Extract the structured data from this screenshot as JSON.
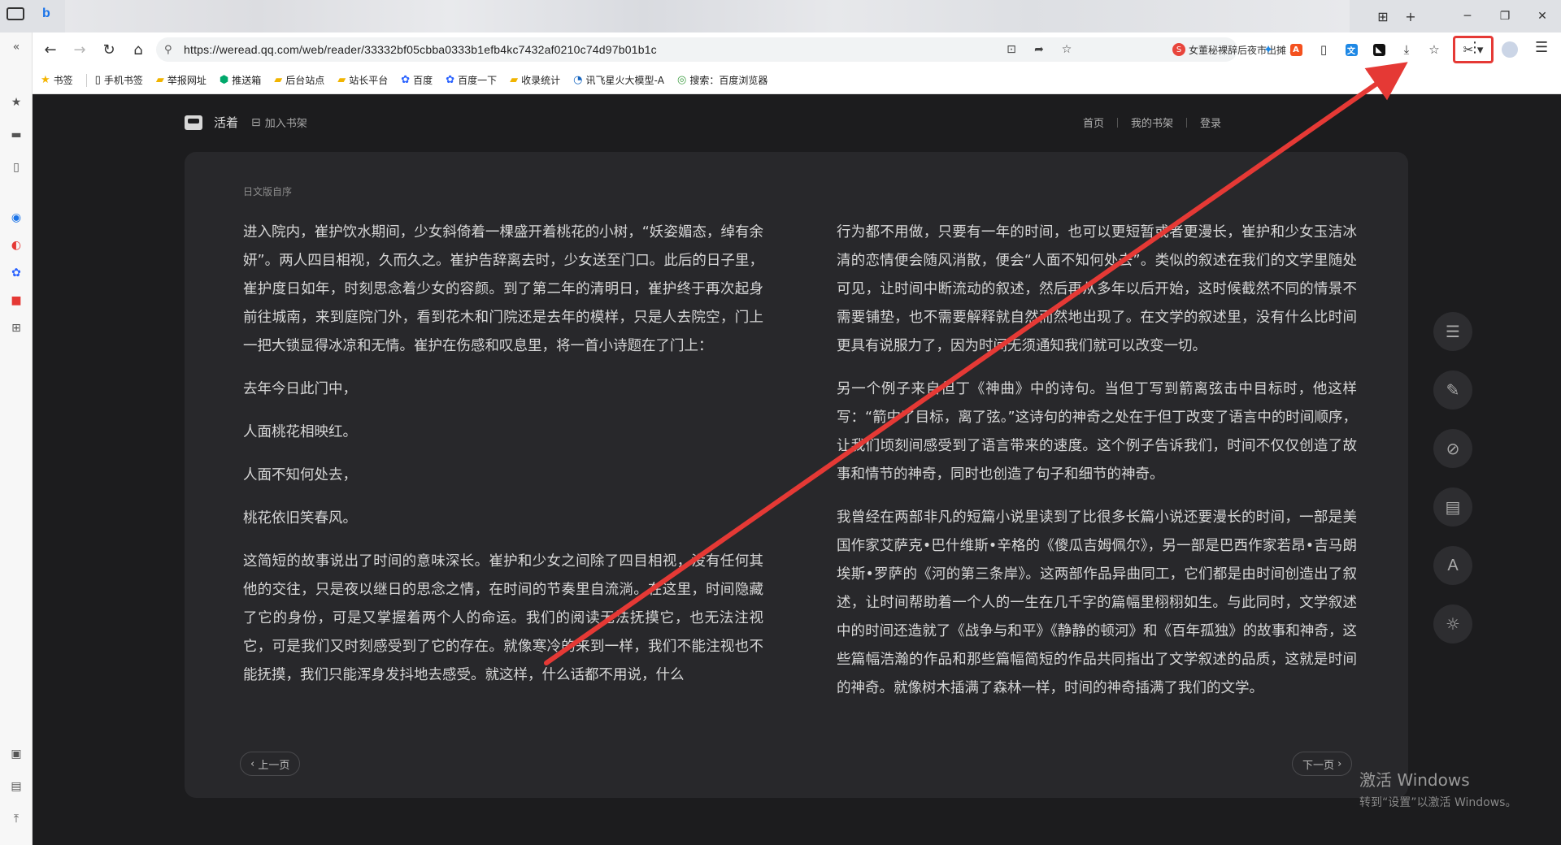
{
  "browser": {
    "address_url": "https://weread.qq.com/web/reader/33332bf05cbba0333b1efb4kc7432af0210c74d97b01b1c",
    "search_hint": "女董秘裸辞后夜市出摊 收",
    "new_tab_label": "+",
    "window": {
      "minimize": "─",
      "restore": "❐",
      "close": "✕"
    }
  },
  "bookmarks": [
    {
      "label": "书签",
      "icon": "star-icon"
    },
    {
      "label": "手机书签",
      "icon": "phone-icon"
    },
    {
      "label": "举报网址",
      "icon": "folder-icon"
    },
    {
      "label": "推送箱",
      "icon": "push-icon"
    },
    {
      "label": "后台站点",
      "icon": "folder-icon"
    },
    {
      "label": "站长平台",
      "icon": "folder-icon"
    },
    {
      "label": "百度",
      "icon": "baidu-icon"
    },
    {
      "label": "百度一下",
      "icon": "baidu-icon"
    },
    {
      "label": "收录统计",
      "icon": "folder-icon"
    },
    {
      "label": "讯飞星火大模型-A",
      "icon": "spark-icon"
    },
    {
      "label": "搜索：百度浏览器",
      "icon": "search-engine-icon"
    }
  ],
  "reader": {
    "book_title": "活着",
    "add_to_shelf": "加入书架",
    "nav": {
      "home": "首页",
      "my_shelf": "我的书架",
      "login": "登录"
    },
    "chapter": "日文版自序",
    "left_paragraphs": [
      "进入院内，崔护饮水期间，少女斜倚着一棵盛开着桃花的小树，“妖姿媚态，绰有余妍”。两人四目相视，久而久之。崔护告辞离去时，少女送至门口。此后的日子里，崔护度日如年，时刻思念着少女的容颜。到了第二年的清明日，崔护终于再次起身前往城南，来到庭院门外，看到花木和门院还是去年的模样，只是人去院空，门上一把大锁显得冰凉和无情。崔护在伤感和叹息里，将一首小诗题在了门上：",
      "去年今日此门中，",
      "人面桃花相映红。",
      "人面不知何处去，",
      "桃花依旧笑春风。",
      "这简短的故事说出了时间的意味深长。崔护和少女之间除了四目相视，没有任何其他的交往，只是夜以继日的思念之情，在时间的节奏里自流淌。在这里，时间隐藏了它的身份，可是又掌握着两个人的命运。我们的阅读无法抚摸它，也无法注视它，可是我们又时刻感受到了它的存在。就像寒冷的来到一样，我们不能注视也不能抚摸，我们只能浑身发抖地去感受。就这样，什么话都不用说，什么"
    ],
    "right_paragraphs": [
      "行为都不用做，只要有一年的时间，也可以更短暂或者更漫长，崔护和少女玉洁冰清的恋情便会随风消散，便会“人面不知何处去”。类似的叙述在我们的文学里随处可见，让时间中断流动的叙述，然后再从多年以后开始，这时候截然不同的情景不需要铺垫，也不需要解释就自然而然地出现了。在文学的叙述里，没有什么比时间更具有说服力了，因为时间无须通知我们就可以改变一切。",
      "另一个例子来自但丁《神曲》中的诗句。当但丁写到箭离弦击中目标时，他这样写：“箭中了目标，离了弦。”这诗句的神奇之处在于但丁改变了语言中的时间顺序，让我们顷刻间感受到了语言带来的速度。这个例子告诉我们，时间不仅仅创造了故事和情节的神奇，同时也创造了句子和细节的神奇。",
      "我曾经在两部非凡的短篇小说里读到了比很多长篇小说还要漫长的时间，一部是美国作家艾萨克•巴什维斯•辛格的《傻瓜吉姆佩尔》，另一部是巴西作家若昂•吉马朗埃斯•罗萨的《河的第三条岸》。这两部作品异曲同工，它们都是由时间创造出了叙述，让时间帮助着一个人的一生在几千字的篇幅里栩栩如生。与此同时，文学叙述中的时间还造就了《战争与和平》《静静的顿河》和《百年孤独》的故事和神奇，这些篇幅浩瀚的作品和那些篇幅简短的作品共同指出了文学叙述的品质，这就是时间的神奇。就像树木插满了森林一样，时间的神奇插满了我们的文学。"
    ],
    "prev_page": "上一页",
    "next_page": "下一页"
  },
  "watermark": {
    "line1": "激活 Windows",
    "line2": "转到“设置”以激活 Windows。"
  },
  "colors": {
    "annotation_arrow": "#e53935",
    "reader_bg": "#1c1c1e",
    "page_bg": "#28282b"
  }
}
